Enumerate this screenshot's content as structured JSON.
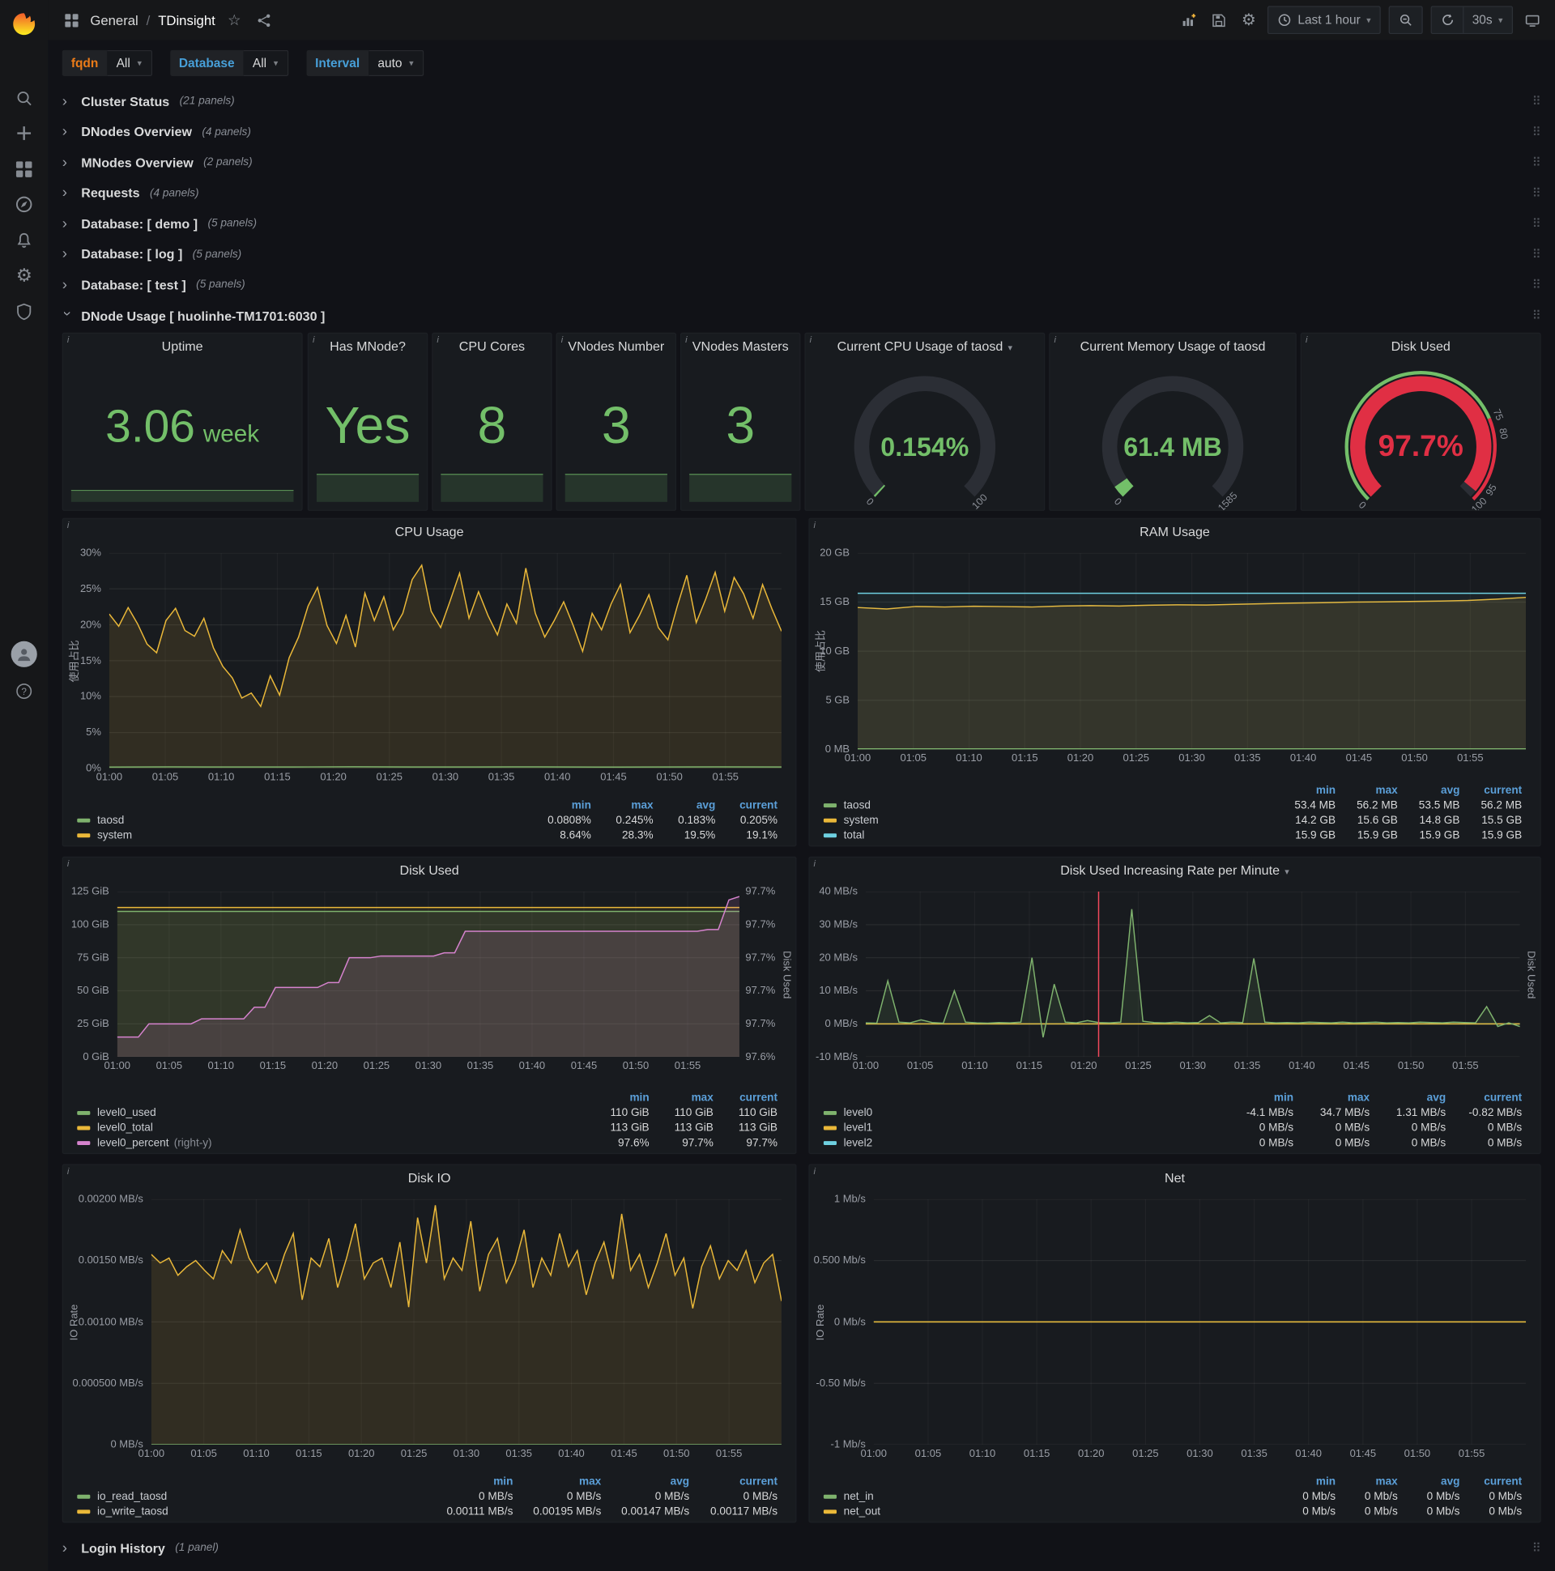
{
  "nav": {
    "breadcrumb_section": "General",
    "breadcrumb_sep": "/",
    "title": "TDinsight",
    "time_range": "Last 1 hour",
    "refresh_interval": "30s"
  },
  "icons": {
    "gear": "⚙",
    "star": "☆",
    "chevron_right": "›",
    "caret_down": "▾",
    "drag_handle": "⠿",
    "help": "?",
    "info": "i",
    "plus": "+"
  },
  "variables": [
    {
      "label": "fqdn",
      "value": "All",
      "label_color": "#EB7B18"
    },
    {
      "label": "Database",
      "value": "All",
      "label_color": "#479FD8"
    },
    {
      "label": "Interval",
      "value": "auto",
      "label_color": "#479FD8"
    }
  ],
  "rows": [
    {
      "title": "Cluster Status",
      "count": "(21 panels)"
    },
    {
      "title": "DNodes Overview",
      "count": "(4 panels)"
    },
    {
      "title": "MNodes Overview",
      "count": "(2 panels)"
    },
    {
      "title": "Requests",
      "count": "(4 panels)"
    },
    {
      "title": "Database: [ demo ]",
      "count": "(5 panels)"
    },
    {
      "title": "Database: [ log ]",
      "count": "(5 panels)"
    },
    {
      "title": "Database: [ test ]",
      "count": "(5 panels)"
    }
  ],
  "dnode_row": {
    "title": "DNode Usage [ huolinhe-TM1701:6030 ]"
  },
  "login_row": {
    "title": "Login History",
    "count": "(1 panel)"
  },
  "stats": [
    {
      "title": "Uptime",
      "value": "3.06",
      "suffix": "week"
    },
    {
      "title": "Has MNode?",
      "value": "Yes"
    },
    {
      "title": "CPU Cores",
      "value": "8"
    },
    {
      "title": "VNodes Number",
      "value": "3"
    },
    {
      "title": "VNodes Masters",
      "value": "3"
    }
  ],
  "gauges": [
    {
      "title": "Current CPU Usage of taosd",
      "value": "0.154%",
      "frac": 0.006,
      "color": "#73BF69",
      "value_size": 26,
      "labels": [
        {
          "v": 0,
          "t": "0"
        },
        {
          "v": 100,
          "t": "100"
        }
      ]
    },
    {
      "title": "Current Memory Usage of taosd",
      "value": "61.4 MB",
      "frac": 0.0387,
      "color": "#73BF69",
      "value_size": 26,
      "labels": [
        {
          "v": 0,
          "t": "0"
        },
        {
          "v": 100,
          "t": "1585"
        }
      ]
    },
    {
      "title": "Disk Used",
      "value": "97.7%",
      "frac": 0.977,
      "color": "#E02F44",
      "value_size": 30,
      "labels": [
        {
          "v": 0,
          "t": "0"
        },
        {
          "v": 75,
          "t": "75"
        },
        {
          "v": 80,
          "t": "80"
        },
        {
          "v": 95,
          "t": "95"
        },
        {
          "v": 100,
          "t": "100"
        }
      ],
      "bands": [
        {
          "from": 0,
          "to": 75,
          "color": "#73BF69"
        },
        {
          "from": 75,
          "to": 100,
          "color": "#E02F44"
        }
      ]
    }
  ],
  "time_ticks": [
    "01:00",
    "01:05",
    "01:10",
    "01:15",
    "01:20",
    "01:25",
    "01:30",
    "01:35",
    "01:40",
    "01:45",
    "01:50",
    "01:55"
  ],
  "charts": {
    "cpu": {
      "type": "line",
      "title": "CPU Usage",
      "y_label": "使用占比",
      "y_ticks": [
        "30%",
        "25%",
        "20%",
        "15%",
        "10%",
        "5%",
        "0%"
      ],
      "y_min": 0,
      "y_max": 30,
      "series": [
        {
          "name": "system",
          "color": "#EAB839",
          "fill": 0.12,
          "data": [
            21.5,
            19.8,
            22.4,
            20.1,
            17.3,
            16.1,
            20.6,
            22.3,
            19.2,
            18.4,
            20.9,
            16.8,
            14.2,
            12.6,
            9.8,
            10.5,
            8.64,
            12.9,
            10.2,
            15.4,
            18.3,
            22.6,
            25.2,
            19.9,
            17.4,
            21.3,
            16.9,
            24.4,
            20.6,
            23.9,
            19.3,
            21.6,
            26.3,
            28.3,
            21.9,
            19.6,
            23.3,
            27.2,
            20.9,
            24.6,
            21.3,
            18.6,
            22.9,
            20.2,
            27.9,
            21.6,
            18.3,
            20.6,
            23.2,
            19.9,
            16.3,
            21.6,
            19.3,
            22.9,
            25.6,
            18.9,
            21.3,
            24.2,
            19.6,
            17.9,
            22.6,
            26.9,
            20.3,
            23.6,
            27.3,
            21.9,
            26.6,
            24.3,
            20.9,
            25.6,
            22.2,
            19.1
          ]
        },
        {
          "name": "taosd",
          "color": "#7EB26D",
          "fill": 0.08,
          "data": [
            0.18,
            0.21,
            0.19,
            0.2,
            0.22,
            0.19,
            0.2,
            0.21,
            0.18,
            0.2,
            0.21,
            0.2
          ]
        }
      ],
      "legend": {
        "headers": [
          "min",
          "max",
          "avg",
          "current"
        ],
        "rows": [
          {
            "name": "taosd",
            "color": "#7EB26D",
            "values": [
              "0.0808%",
              "0.245%",
              "0.183%",
              "0.205%"
            ]
          },
          {
            "name": "system",
            "color": "#EAB839",
            "values": [
              "8.64%",
              "28.3%",
              "19.5%",
              "19.1%"
            ]
          }
        ]
      }
    },
    "ram": {
      "type": "line",
      "title": "RAM Usage",
      "y_label": "使用占比",
      "y_ticks": [
        "20 GB",
        "15 GB",
        "10 GB",
        "5 GB",
        "0 MB"
      ],
      "y_min": 0,
      "y_max": 20,
      "series": [
        {
          "name": "system",
          "color": "#EAB839",
          "fill": 0.12,
          "data": [
            14.45,
            14.3,
            14.55,
            14.5,
            14.58,
            14.54,
            14.5,
            14.6,
            14.64,
            14.6,
            14.68,
            14.72,
            14.7,
            14.78,
            14.84,
            14.9,
            14.94,
            15.0,
            15.02,
            15.06,
            15.1,
            15.16,
            15.3,
            15.48
          ]
        },
        {
          "name": "total",
          "color": "#6ED0E0",
          "fill": 0.05,
          "data": [
            15.9,
            15.9,
            15.9,
            15.9,
            15.9,
            15.9,
            15.9,
            15.9,
            15.9,
            15.9,
            15.9,
            15.9
          ]
        },
        {
          "name": "taosd",
          "color": "#7EB26D",
          "fill": 0,
          "data": [
            0.055,
            0.055,
            0.055,
            0.055,
            0.055,
            0.055,
            0.055,
            0.055,
            0.055,
            0.055,
            0.055,
            0.055
          ]
        }
      ],
      "legend": {
        "headers": [
          "min",
          "max",
          "avg",
          "current"
        ],
        "rows": [
          {
            "name": "taosd",
            "color": "#7EB26D",
            "values": [
              "53.4 MB",
              "56.2 MB",
              "53.5 MB",
              "56.2 MB"
            ]
          },
          {
            "name": "system",
            "color": "#EAB839",
            "values": [
              "14.2 GB",
              "15.6 GB",
              "14.8 GB",
              "15.5 GB"
            ]
          },
          {
            "name": "total",
            "color": "#6ED0E0",
            "values": [
              "15.9 GB",
              "15.9 GB",
              "15.9 GB",
              "15.9 GB"
            ]
          }
        ]
      }
    },
    "disk_used": {
      "type": "line",
      "title": "Disk Used",
      "y_ticks": [
        "125 GiB",
        "100 GiB",
        "75 GiB",
        "50 GiB",
        "25 GiB",
        "0 GiB"
      ],
      "y_min": 0,
      "y_max": 125,
      "right_ticks": [
        "97.7%",
        "97.7%",
        "97.7%",
        "97.7%",
        "97.7%",
        "97.6%"
      ],
      "right_min": 97.6,
      "right_max": 97.7,
      "right_label": "Disk Used",
      "series": [
        {
          "name": "level0_total",
          "color": "#EAB839",
          "fill": 0.07,
          "data": [
            113,
            113,
            113,
            113,
            113,
            113,
            113,
            113,
            113,
            113,
            113,
            113
          ]
        },
        {
          "name": "level0_used",
          "color": "#7EB26D",
          "fill": 0.12,
          "data": [
            110,
            110,
            110,
            110,
            110,
            110,
            110,
            110,
            110,
            110,
            110,
            110
          ]
        },
        {
          "name": "level0_percent",
          "color": "#D683CE",
          "fill": 0.14,
          "axis": "right",
          "data": [
            97.612,
            97.612,
            97.612,
            97.62,
            97.62,
            97.62,
            97.62,
            97.62,
            97.623,
            97.623,
            97.623,
            97.623,
            97.623,
            97.63,
            97.63,
            97.642,
            97.642,
            97.642,
            97.642,
            97.642,
            97.645,
            97.645,
            97.66,
            97.66,
            97.66,
            97.661,
            97.661,
            97.661,
            97.661,
            97.661,
            97.661,
            97.663,
            97.663,
            97.676,
            97.676,
            97.676,
            97.676,
            97.676,
            97.676,
            97.676,
            97.676,
            97.676,
            97.676,
            97.676,
            97.676,
            97.676,
            97.676,
            97.676,
            97.676,
            97.676,
            97.676,
            97.676,
            97.676,
            97.676,
            97.676,
            97.676,
            97.677,
            97.677,
            97.695,
            97.697
          ]
        }
      ],
      "legend": {
        "headers": [
          "min",
          "max",
          "current"
        ],
        "rows": [
          {
            "name": "level0_used",
            "color": "#7EB26D",
            "values": [
              "110 GiB",
              "110 GiB",
              "110 GiB"
            ]
          },
          {
            "name": "level0_total",
            "color": "#EAB839",
            "values": [
              "113 GiB",
              "113 GiB",
              "113 GiB"
            ]
          },
          {
            "name": "level0_percent",
            "color": "#D683CE",
            "note": "(right-y)",
            "values": [
              "97.6%",
              "97.7%",
              "97.7%"
            ]
          }
        ]
      }
    },
    "disk_rate": {
      "type": "line",
      "title": "Disk Used Increasing Rate per Minute",
      "title_caret": true,
      "y_ticks": [
        "40 MB/s",
        "30 MB/s",
        "20 MB/s",
        "10 MB/s",
        "0 MB/s",
        "-10 MB/s"
      ],
      "y_min": -10,
      "y_max": 40,
      "right_label": "Disk Used",
      "annotation_frac": 0.356,
      "series": [
        {
          "name": "level2",
          "color": "#6ED0E0",
          "fill": 0,
          "data": [
            0,
            0,
            0,
            0,
            0,
            0,
            0,
            0,
            0,
            0,
            0,
            0
          ]
        },
        {
          "name": "level1",
          "color": "#EAB839",
          "fill": 0,
          "data": [
            0,
            0,
            0,
            0,
            0,
            0,
            0,
            0,
            0,
            0,
            0,
            0
          ]
        },
        {
          "name": "level0",
          "color": "#7EB26D",
          "fill": 0.12,
          "data": [
            0.3,
            0.2,
            13,
            0.5,
            0.3,
            1.2,
            0.4,
            0.2,
            10,
            0.5,
            0.3,
            0.2,
            0.4,
            0.3,
            0.5,
            20,
            -4.1,
            12,
            0.5,
            0.3,
            1,
            0.4,
            0.3,
            0.5,
            34.7,
            0.8,
            0.4,
            0.3,
            0.5,
            0.3,
            0.4,
            2.5,
            0.3,
            0.5,
            0.4,
            19.8,
            0.5,
            0.3,
            0.4,
            0.3,
            0.5,
            0.4,
            0.3,
            0.5,
            0.3,
            0.4,
            0.5,
            0.3,
            0.4,
            0.3,
            0.5,
            0.4,
            0.3,
            0.5,
            0.4,
            0.3,
            5.2,
            -0.8,
            0.3,
            -0.82
          ]
        }
      ],
      "legend": {
        "headers": [
          "min",
          "max",
          "avg",
          "current"
        ],
        "rows": [
          {
            "name": "level0",
            "color": "#7EB26D",
            "values": [
              "-4.1 MB/s",
              "34.7 MB/s",
              "1.31 MB/s",
              "-0.82 MB/s"
            ]
          },
          {
            "name": "level1",
            "color": "#EAB839",
            "values": [
              "0 MB/s",
              "0 MB/s",
              "0 MB/s",
              "0 MB/s"
            ]
          },
          {
            "name": "level2",
            "color": "#6ED0E0",
            "values": [
              "0 MB/s",
              "0 MB/s",
              "0 MB/s",
              "0 MB/s"
            ]
          }
        ]
      }
    },
    "disk_io": {
      "type": "line",
      "title": "Disk IO",
      "y_label": "IO Rate",
      "y_ticks": [
        "0.00200 MB/s",
        "0.00150 MB/s",
        "0.00100 MB/s",
        "0.000500 MB/s",
        "0 MB/s"
      ],
      "y_min": 0,
      "y_max": 0.002,
      "series": [
        {
          "name": "io_write_taosd",
          "color": "#EAB839",
          "fill": 0.12,
          "data": [
            0.00155,
            0.00148,
            0.00152,
            0.00138,
            0.00145,
            0.0015,
            0.00142,
            0.00135,
            0.00158,
            0.00148,
            0.00175,
            0.00152,
            0.0014,
            0.00148,
            0.00132,
            0.00155,
            0.00172,
            0.00118,
            0.00152,
            0.00145,
            0.00168,
            0.00128,
            0.00152,
            0.0018,
            0.00135,
            0.00148,
            0.00152,
            0.00128,
            0.00165,
            0.00112,
            0.00185,
            0.00148,
            0.00195,
            0.00135,
            0.00152,
            0.00142,
            0.00182,
            0.00125,
            0.00155,
            0.00168,
            0.00132,
            0.00148,
            0.00175,
            0.00128,
            0.00152,
            0.00138,
            0.00172,
            0.00145,
            0.00158,
            0.00122,
            0.00148,
            0.00165,
            0.00135,
            0.00188,
            0.00142,
            0.00155,
            0.00128,
            0.00148,
            0.00172,
            0.00138,
            0.00152,
            0.00111,
            0.00145,
            0.00162,
            0.00135,
            0.0015,
            0.00142,
            0.00158,
            0.00132,
            0.00148,
            0.00155,
            0.00117
          ]
        },
        {
          "name": "io_read_taosd",
          "color": "#7EB26D",
          "fill": 0,
          "data": [
            0,
            0,
            0,
            0,
            0,
            0,
            0,
            0,
            0,
            0,
            0,
            0
          ]
        }
      ],
      "legend": {
        "headers": [
          "min",
          "max",
          "avg",
          "current"
        ],
        "rows": [
          {
            "name": "io_read_taosd",
            "color": "#7EB26D",
            "values": [
              "0 MB/s",
              "0 MB/s",
              "0 MB/s",
              "0 MB/s"
            ]
          },
          {
            "name": "io_write_taosd",
            "color": "#EAB839",
            "values": [
              "0.00111 MB/s",
              "0.00195 MB/s",
              "0.00147 MB/s",
              "0.00117 MB/s"
            ]
          }
        ]
      }
    },
    "net": {
      "type": "line",
      "title": "Net",
      "y_label": "IO Rate",
      "y_ticks": [
        "1 Mb/s",
        "0.500 Mb/s",
        "0 Mb/s",
        "-0.50 Mb/s",
        "-1 Mb/s"
      ],
      "y_min": -1,
      "y_max": 1,
      "series": [
        {
          "name": "net_in",
          "color": "#7EB26D",
          "fill": 0,
          "data": [
            0,
            0,
            0,
            0,
            0,
            0,
            0,
            0,
            0,
            0,
            0,
            0
          ]
        },
        {
          "name": "net_out",
          "color": "#EAB839",
          "fill": 0,
          "data": [
            0,
            0,
            0,
            0,
            0,
            0,
            0,
            0,
            0,
            0,
            0,
            0
          ]
        }
      ],
      "legend": {
        "headers": [
          "min",
          "max",
          "avg",
          "current"
        ],
        "rows": [
          {
            "name": "net_in",
            "color": "#7EB26D",
            "values": [
              "0 Mb/s",
              "0 Mb/s",
              "0 Mb/s",
              "0 Mb/s"
            ]
          },
          {
            "name": "net_out",
            "color": "#EAB839",
            "values": [
              "0 Mb/s",
              "0 Mb/s",
              "0 Mb/s",
              "0 Mb/s"
            ]
          }
        ]
      }
    }
  }
}
